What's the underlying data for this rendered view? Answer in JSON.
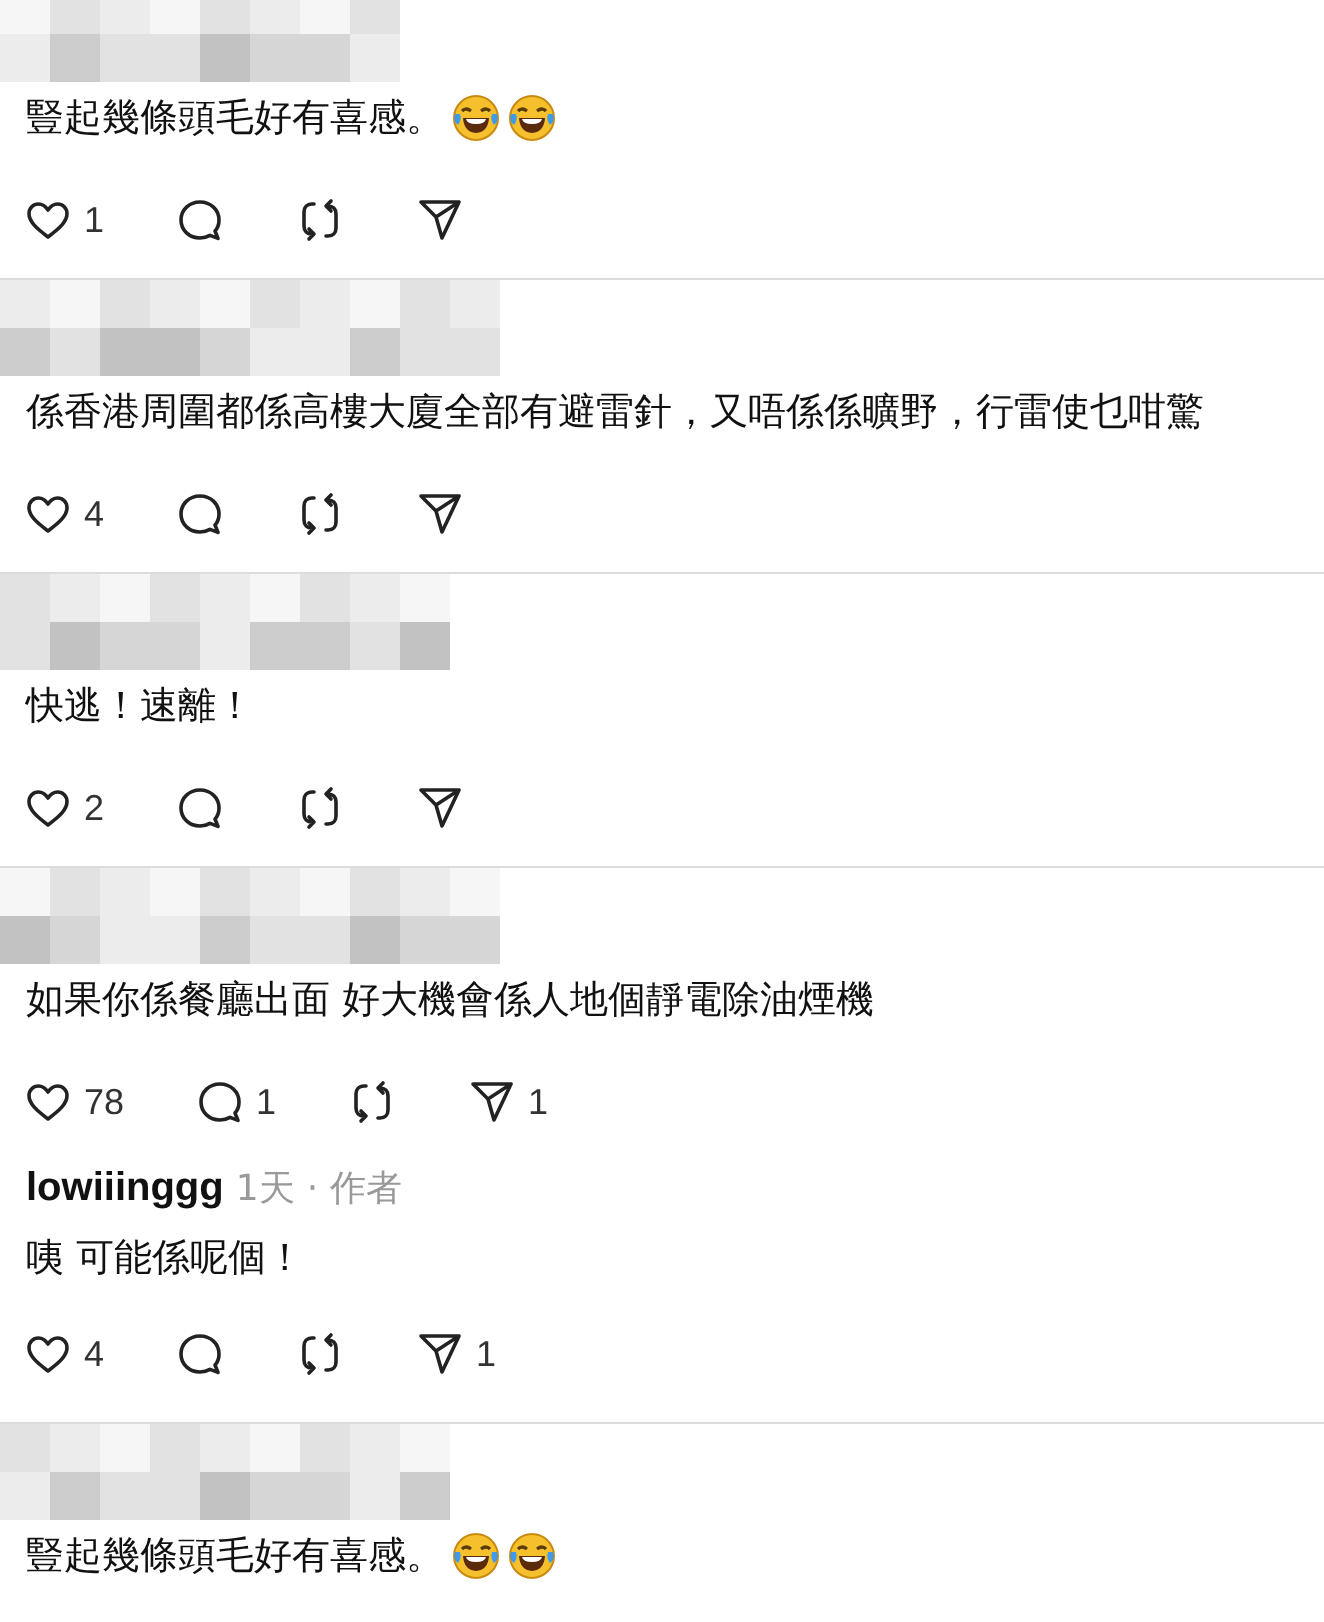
{
  "comments": [
    {
      "author": {
        "kind": "pixelated"
      },
      "text": "豎起幾條頭毛好有喜感。",
      "emoji": [
        {
          "kind": "laughing"
        },
        {
          "kind": "laughing"
        }
      ],
      "actions": {
        "likes": "1"
      }
    },
    {
      "author": {
        "kind": "pixelated"
      },
      "text": "係香港周圍都係高樓大廈全部有避雷針，又唔係係曠野，行雷使乜咁驚",
      "actions": {
        "likes": "4"
      }
    },
    {
      "author": {
        "kind": "pixelated"
      },
      "text": "快逃！速離！",
      "actions": {
        "likes": "2"
      }
    },
    {
      "author": {
        "kind": "pixelated"
      },
      "text": "如果你係餐廳出面 好大機會係人地個靜電除油煙機",
      "actions": {
        "likes": "78",
        "replies": "1",
        "shares": "1"
      }
    },
    {
      "author": {
        "kind": "named",
        "name": "lowiiinggg",
        "time": "1天",
        "separator": "·",
        "badge": "作者"
      },
      "text": "咦 可能係呢個！",
      "actions": {
        "likes": "4",
        "shares": "1"
      }
    },
    {
      "author": {
        "kind": "pixelated"
      },
      "text": "豎起幾條頭毛好有喜感。",
      "emoji": [
        {
          "kind": "laughing"
        },
        {
          "kind": "laughing"
        }
      ]
    }
  ]
}
